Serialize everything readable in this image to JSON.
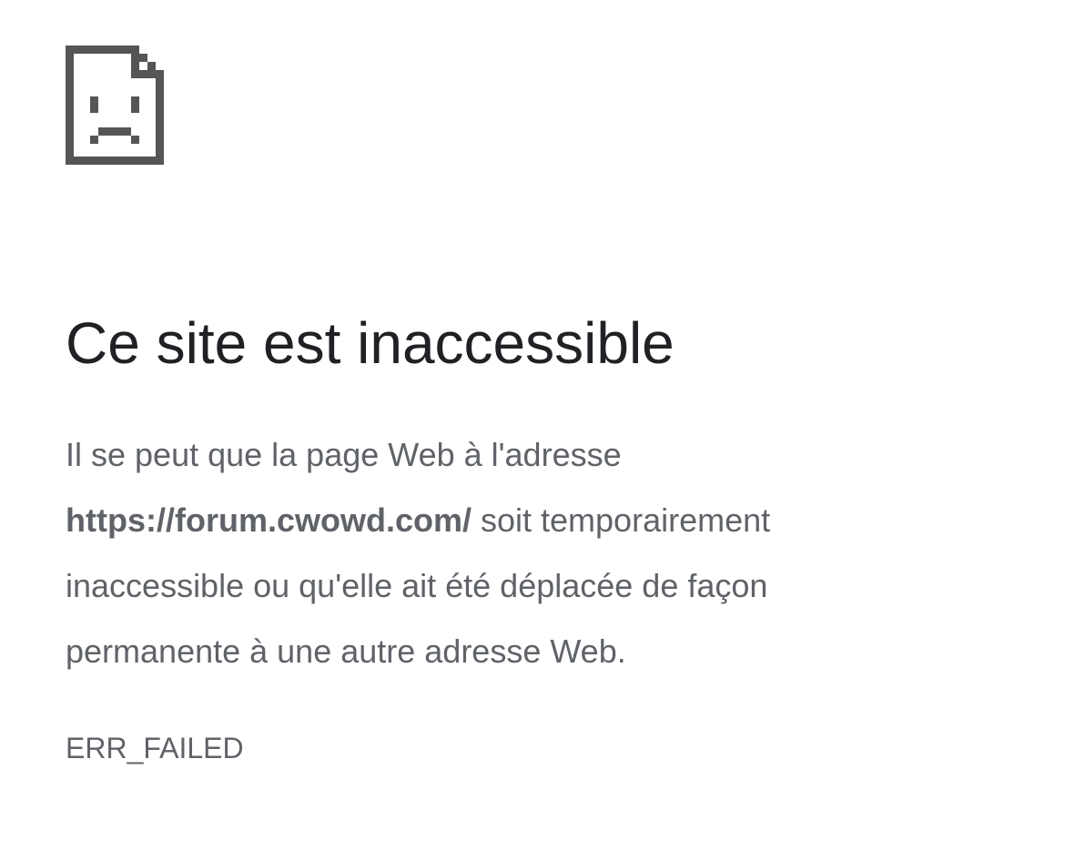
{
  "error_page": {
    "icon": "sad-page-icon",
    "title": "Ce site est inaccessible",
    "summary": {
      "line1": "Il se peut que la page Web à l'adresse",
      "url": "https://forum.cwowd.com/",
      "line2_rest": " soit temporairement",
      "line3": "inaccessible ou qu'elle ait été déplacée de façon",
      "line4": "permanente à une autre adresse Web."
    },
    "error_code": "ERR_FAILED"
  },
  "colors": {
    "icon": "#555555",
    "title": "#202124",
    "body_text": "#5f6368",
    "background": "#ffffff"
  }
}
